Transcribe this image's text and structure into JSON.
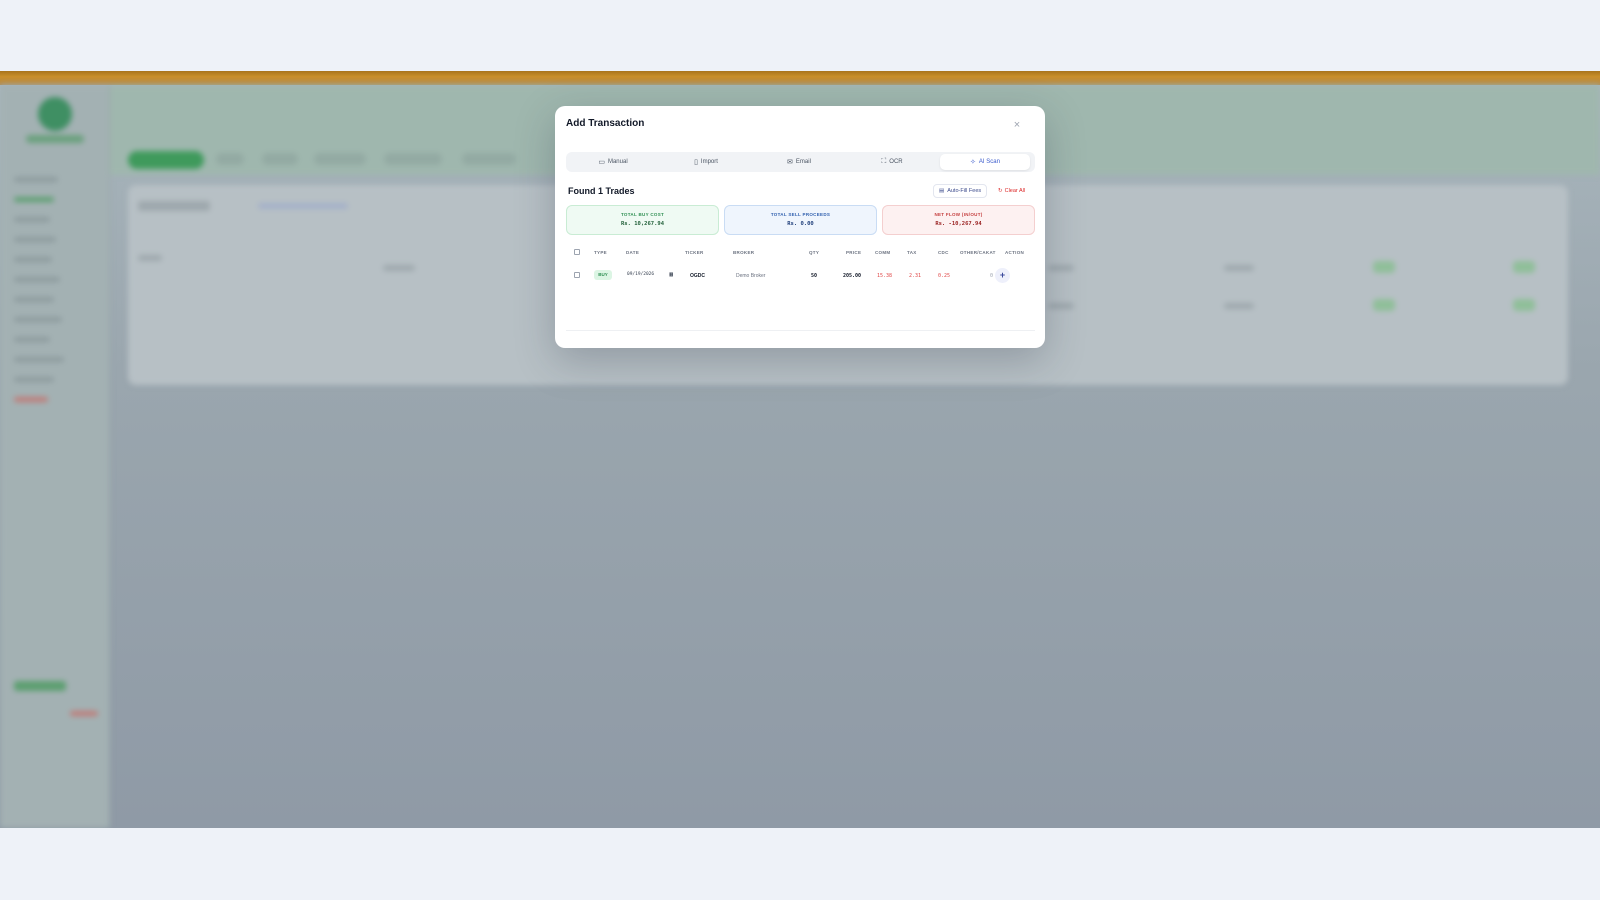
{
  "modal": {
    "title": "Add Transaction",
    "close_icon": "×",
    "tabs": [
      {
        "label": "Manual",
        "icon": "▭",
        "icon_name": "keyboard-icon"
      },
      {
        "label": "Import",
        "icon": "▯",
        "icon_name": "file-icon"
      },
      {
        "label": "Email",
        "icon": "✉",
        "icon_name": "mail-icon"
      },
      {
        "label": "OCR",
        "icon": "⛶",
        "icon_name": "scan-icon"
      },
      {
        "label": "AI Scan",
        "icon": "✧",
        "icon_name": "sparkle-icon",
        "active": true
      }
    ],
    "found_title": "Found 1 Trades",
    "autofill_label": "Auto-Fill Fees",
    "clear_label": "Clear All",
    "summary": {
      "buy_label": "TOTAL BUY COST",
      "buy_value": "Rs. 10,267.94",
      "sell_label": "TOTAL SELL PROCEEDS",
      "sell_value": "Rs. 0.00",
      "net_label": "NET FLOW (IN/OUT)",
      "net_value": "Rs. -10,267.94"
    },
    "table": {
      "headers": {
        "type": "TYPE",
        "date": "DATE",
        "ticker": "TICKER",
        "broker": "BROKER",
        "qty": "QTY",
        "price": "PRICE",
        "comm": "COMM",
        "tax": "TAX",
        "cdc": "CDC",
        "other": "OTHER/CAKAT",
        "action": "ACTION"
      },
      "rows": [
        {
          "type": "BUY",
          "date": "09/19/2026",
          "ticker": "OGDC",
          "broker": "Demo Broker",
          "qty": "50",
          "price": "205.00",
          "comm": "15.38",
          "tax": "2.31",
          "cdc": "0.25",
          "other": "0",
          "action": "+"
        }
      ]
    }
  },
  "colors": {
    "accent_bar": "#c98f2a",
    "buy_green": "#2f8f53",
    "sell_blue": "#2f5fae",
    "net_red": "#c43c3c",
    "active_tab": "#3b5bcc"
  }
}
